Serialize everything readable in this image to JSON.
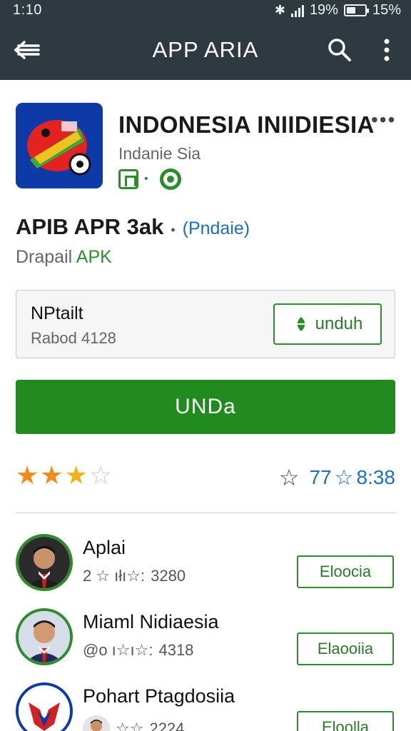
{
  "status_bar": {
    "time": "1:10",
    "signal_percent": "19%",
    "battery_percent": "15%"
  },
  "app_bar": {
    "title": "APP ARIA",
    "back_icon": "back-arrow-icon",
    "search_icon": "search-icon",
    "more_icon": "more-vert-icon"
  },
  "app": {
    "name": "INDONESIA INIIDIESIA",
    "developer": "Indanie Sia",
    "more_label": "•••",
    "version_text": "APIB APR 3ak",
    "separator": "•",
    "tag": "(Pndaie)",
    "sub_prefix": "Drapail ",
    "sub_apk": "APK"
  },
  "card": {
    "title": "NPtailt",
    "subtitle": "Rabod 4128",
    "button_label": "unduh"
  },
  "primary_button": {
    "label": "UNDa"
  },
  "rating": {
    "stars_full": 2,
    "stars_half": 1,
    "stars_total": 4,
    "count_a": "77",
    "count_b": "8:38"
  },
  "list": [
    {
      "title": "Aplai",
      "sub_prefix": "2 ☆ ıłı☆:",
      "sub_value": "3280",
      "button": "Eloocia"
    },
    {
      "title": "Miaml Nidiaesia",
      "sub_prefix": "@o ı☆ı☆:",
      "sub_value": "4318",
      "button": "Elaooiia"
    },
    {
      "title": "Pohart Ptagdosiia",
      "sub_prefix": "☆☆",
      "sub_value": "2224",
      "button": "Eloolla"
    }
  ],
  "colors": {
    "bar": "#2f3a40",
    "green": "#228b1f",
    "blue_link": "#1f6fb2",
    "star_orange": "#f08c1a"
  }
}
